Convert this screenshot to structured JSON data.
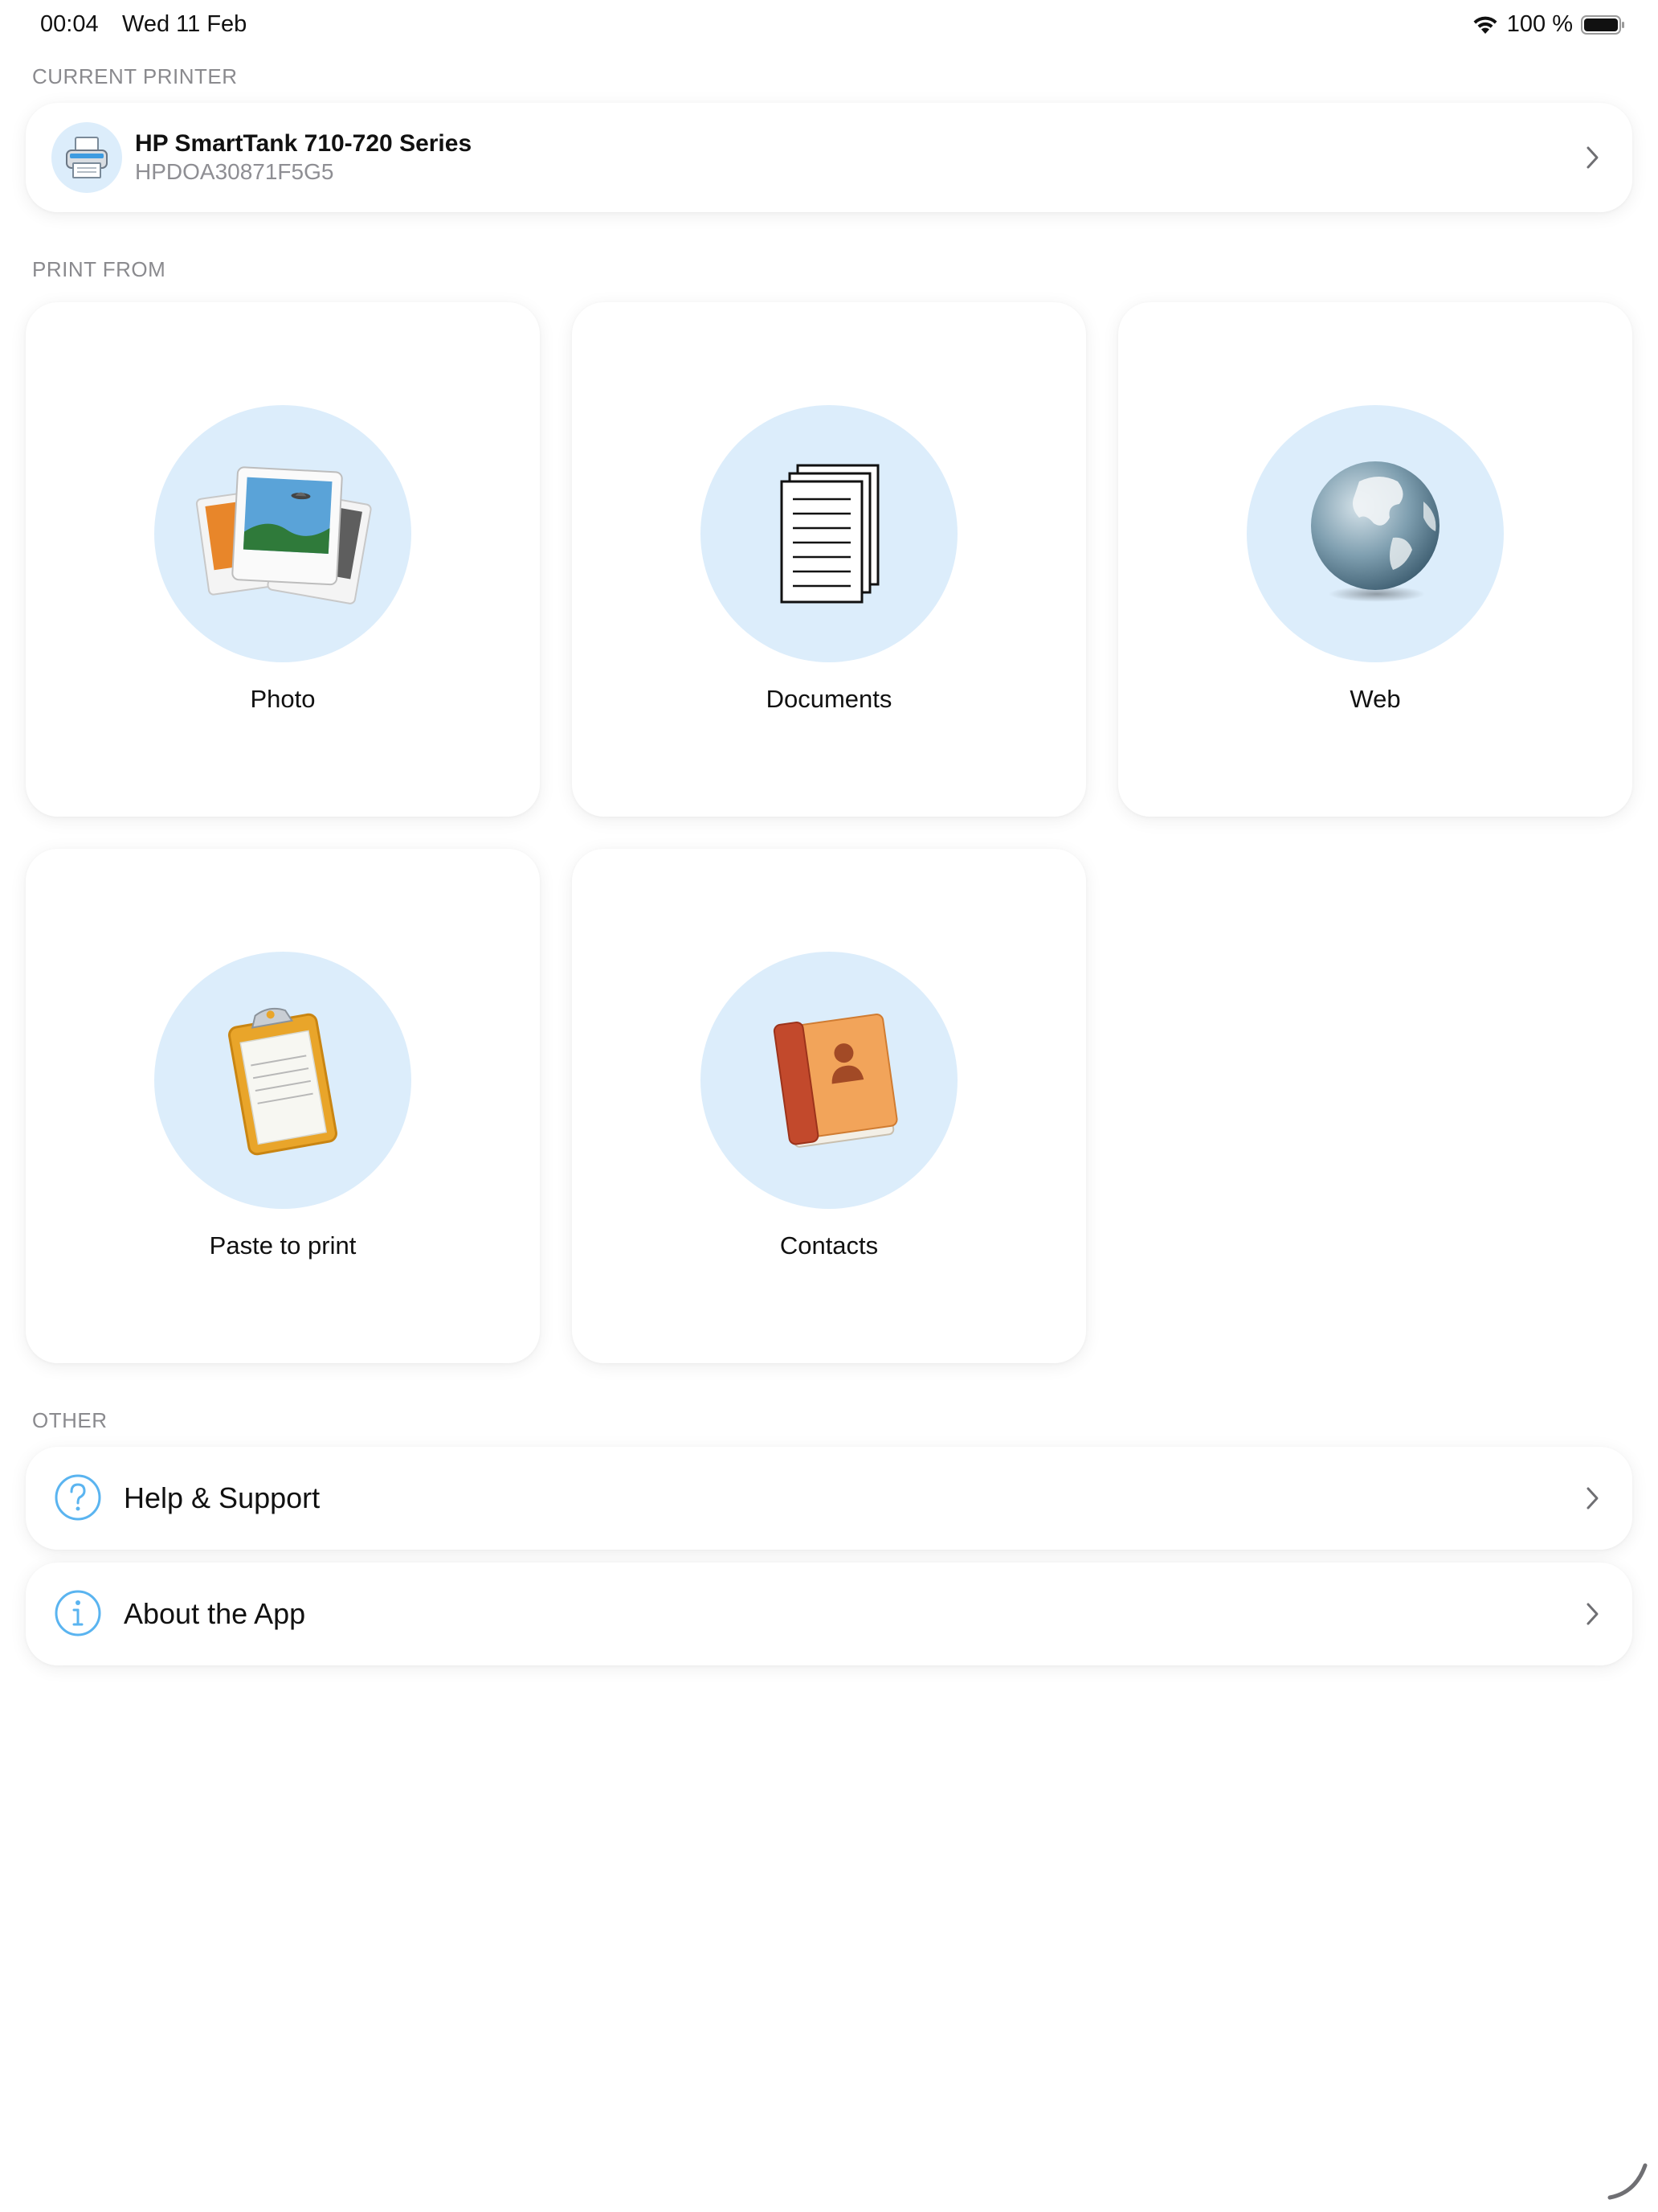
{
  "status_bar": {
    "time": "00:04",
    "date": "Wed 11 Feb",
    "battery_text": "100 %",
    "icons": [
      "wifi-icon",
      "battery-icon"
    ]
  },
  "sections": {
    "current_printer": "CURRENT PRINTER",
    "print_from": "PRINT FROM",
    "other": "OTHER"
  },
  "printer": {
    "name": "HP SmartTank 710-720 Series",
    "id": "HPDOA30871F5G5",
    "icon": "printer-icon"
  },
  "print_from": [
    {
      "label": "Photo",
      "icon": "photo-icon"
    },
    {
      "label": "Documents",
      "icon": "documents-icon"
    },
    {
      "label": "Web",
      "icon": "globe-icon"
    },
    {
      "label": "Paste to print",
      "icon": "clipboard-icon"
    },
    {
      "label": "Contacts",
      "icon": "contacts-book-icon"
    }
  ],
  "other": [
    {
      "label": "Help & Support",
      "icon": "question-circle-icon"
    },
    {
      "label": "About the App",
      "icon": "info-circle-icon"
    }
  ],
  "colors": {
    "accent_light_blue": "#dcedfb",
    "icon_blue": "#5ab4f0",
    "section_gray": "#8a8a8e",
    "subtitle_gray": "#8e8e93"
  }
}
